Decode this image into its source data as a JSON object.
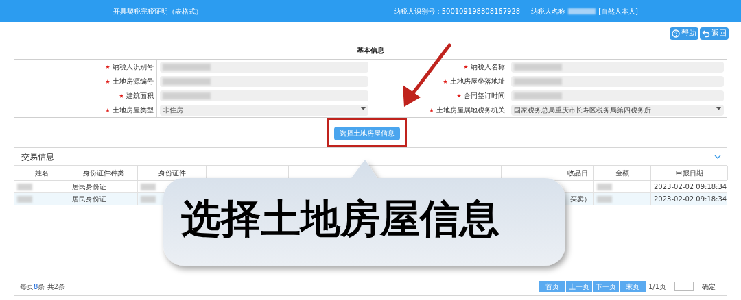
{
  "header": {
    "title": "开具契税完税证明（表格式）",
    "taxpayer_id": "纳税人识别号：500109198808167928",
    "taxpayer_name_label": "纳税人名称",
    "taxpayer_type": "[自然人本人]"
  },
  "toolbar": [
    {
      "kind": "help",
      "label": "帮助"
    },
    {
      "kind": "back",
      "label": "返回"
    }
  ],
  "basic_info": {
    "title": "基本信息",
    "rows": [
      [
        {
          "label": "纳税人识别号",
          "required": true,
          "kind": "redacted"
        },
        {
          "label": "纳税人名称",
          "required": true,
          "kind": "redacted"
        }
      ],
      [
        {
          "label": "土地房源编号",
          "required": true,
          "kind": "redacted"
        },
        {
          "label": "土地房屋坐落地址",
          "required": true,
          "kind": "redacted"
        }
      ],
      [
        {
          "label": "建筑面积",
          "required": true,
          "kind": "redacted"
        },
        {
          "label": "合同签订时间",
          "required": true,
          "kind": "redacted"
        }
      ],
      [
        {
          "label": "土地房屋类型",
          "required": true,
          "kind": "select",
          "value": "非住房"
        },
        {
          "label": "土地房屋属地税务机关",
          "required": true,
          "kind": "select",
          "value": "国家税务总局重庆市长寿区税务局第四税务所"
        }
      ]
    ]
  },
  "select_button": "选择土地房屋信息",
  "transactions": {
    "title": "交易信息",
    "expanded": true,
    "columns": [
      "姓名",
      "身份证件种类",
      "身份证件",
      "",
      "",
      "",
      "收品日",
      "金额",
      "申报日期"
    ],
    "rows": [
      {
        "selected": false,
        "cells": [
          {
            "kind": "redacted"
          },
          {
            "kind": "text",
            "text": "居民身份证"
          },
          {
            "kind": "redacted"
          },
          {
            "kind": "empty"
          },
          {
            "kind": "empty"
          },
          {
            "kind": "empty"
          },
          {
            "kind": "empty"
          },
          {
            "kind": "redacted"
          },
          {
            "kind": "text",
            "text": "2023-02-02 09:18:34"
          }
        ]
      },
      {
        "selected": true,
        "cells": [
          {
            "kind": "redacted"
          },
          {
            "kind": "text",
            "text": "居民身份证"
          },
          {
            "kind": "redacted"
          },
          {
            "kind": "empty"
          },
          {
            "kind": "empty"
          },
          {
            "kind": "empty"
          },
          {
            "kind": "text",
            "text": "买卖）"
          },
          {
            "kind": "redacted"
          },
          {
            "kind": "text",
            "text": "2023-02-02 09:18:34"
          }
        ]
      }
    ],
    "footer": {
      "per_page_prefix": "每页",
      "per_page": "8",
      "per_page_suffix": "条 共2条"
    },
    "pagination": {
      "buttons": [
        "首页",
        "上一页",
        "下一页",
        "末页"
      ],
      "page_info": "1/1页",
      "confirm": "确定"
    }
  },
  "callout": {
    "text": "选择土地房屋信息"
  }
}
